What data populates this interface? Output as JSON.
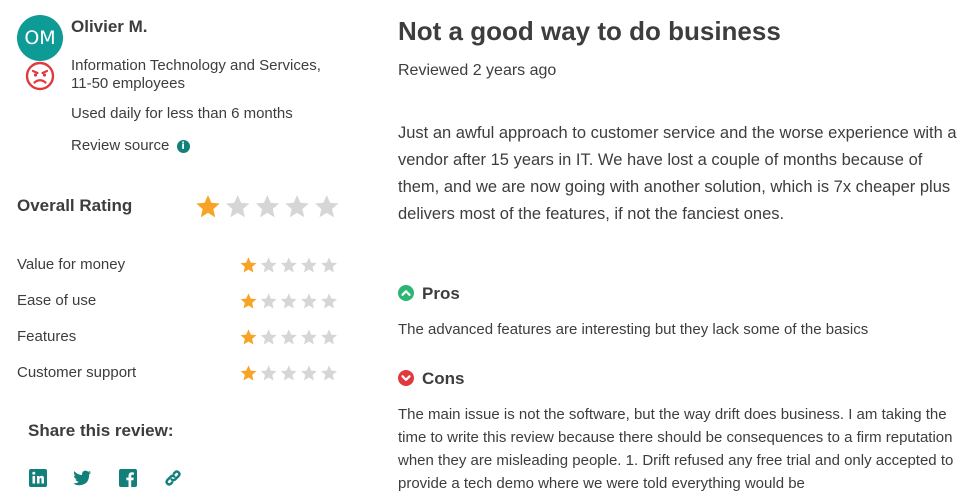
{
  "reviewer": {
    "initials": "OM",
    "name": "Olivier M.",
    "industry_line1": "Information Technology and Services,",
    "industry_line2": "11-50 employees",
    "usage": "Used daily for less than 6 months",
    "source": "Review source",
    "mood_icon": "angry-face-icon",
    "info_icon": "info-icon"
  },
  "ratings": {
    "overall_label": "Overall Rating",
    "overall_value": 1,
    "max": 5,
    "items": [
      {
        "label": "Value for money",
        "value": 1
      },
      {
        "label": "Ease of use",
        "value": 1
      },
      {
        "label": "Features",
        "value": 1
      },
      {
        "label": "Customer support",
        "value": 1
      }
    ]
  },
  "share": {
    "label": "Share this review:",
    "icons": [
      "linkedin-icon",
      "twitter-icon",
      "facebook-icon",
      "link-icon"
    ]
  },
  "review": {
    "title": "Not a good way to do business",
    "date": "Reviewed 2 years ago",
    "body": "Just an awful approach to customer service and the worse experience with a vendor after 15 years in IT. We have lost a couple of months because of them, and we are now going with another solution, which is 7x cheaper plus delivers most of the features, if not the fanciest ones.",
    "pros_label": "Pros",
    "pros_text": "The advanced features are interesting but they lack some of the basics",
    "cons_label": "Cons",
    "cons_text": "The main issue is not the software, but the way drift does business. I am taking the time to write this review because there should be consequences to a firm reputation when they are misleading people. 1. Drift refused any free trial and only accepted to provide a tech demo where we were told everything would be"
  },
  "colors": {
    "star_filled": "#f7a325",
    "star_empty": "#d6d6d6",
    "accent": "#12807a",
    "avatar_bg": "#0f9b95",
    "pros": "#2bb673",
    "cons": "#e0393e"
  }
}
